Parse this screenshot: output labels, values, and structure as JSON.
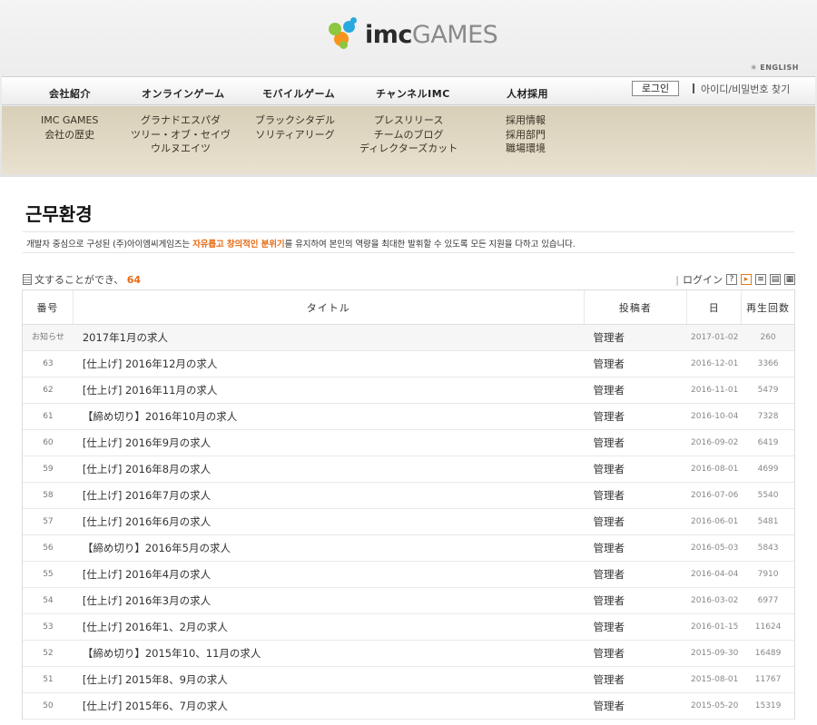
{
  "brand": {
    "logo_main": "imc",
    "logo_sub": "GAMES"
  },
  "header": {
    "lang_link": "ENGLISH",
    "menu": [
      "会社紹介",
      "オンラインゲーム",
      "モバイルゲーム",
      "チャンネルIMC",
      "人材採用"
    ],
    "login_button": "로그인",
    "find_link": "아이디/비밀번호 찾기"
  },
  "submenu": {
    "col1": [
      "IMC GAMES",
      "会社の歴史"
    ],
    "col2": [
      "グラナドエスパダ",
      "ツリー・オブ・セイヴ",
      "ウルヌエイツ"
    ],
    "col3": [
      "ブラックシタデル",
      "ソリティアリーグ"
    ],
    "col4": [
      "プレスリリース",
      "チームのブログ",
      "ディレクターズカット"
    ],
    "col5": [
      "採用情報",
      "採用部門",
      "職場環境"
    ]
  },
  "page": {
    "title": "근무환경",
    "desc_before": "개발자 중심으로 구성된 (주)아이엠씨게임즈는 ",
    "desc_highlight": "자유롭고 창의적인 분위기",
    "desc_after": "를 유지하여 본인의 역량을 최대한 발휘할 수 있도록 모든 지원을 다하고 있습니다."
  },
  "board": {
    "count_label": "文することができ、",
    "count_value": "64",
    "login_label": "ログイン",
    "columns": {
      "no": "番号",
      "title": "タイトル",
      "author": "投稿者",
      "date": "日",
      "views": "再生回数"
    },
    "rows": [
      {
        "no": "お知らせ",
        "title": "2017年1月の求人",
        "author": "管理者",
        "date": "2017-01-02",
        "views": "260",
        "notice": true
      },
      {
        "no": "63",
        "title": "[仕上げ] 2016年12月の求人",
        "author": "管理者",
        "date": "2016-12-01",
        "views": "3366"
      },
      {
        "no": "62",
        "title": "[仕上げ] 2016年11月の求人",
        "author": "管理者",
        "date": "2016-11-01",
        "views": "5479"
      },
      {
        "no": "61",
        "title": "【締め切り】2016年10月の求人",
        "author": "管理者",
        "date": "2016-10-04",
        "views": "7328"
      },
      {
        "no": "60",
        "title": "[仕上げ] 2016年9月の求人",
        "author": "管理者",
        "date": "2016-09-02",
        "views": "6419"
      },
      {
        "no": "59",
        "title": "[仕上げ] 2016年8月の求人",
        "author": "管理者",
        "date": "2016-08-01",
        "views": "4699"
      },
      {
        "no": "58",
        "title": "[仕上げ] 2016年7月の求人",
        "author": "管理者",
        "date": "2016-07-06",
        "views": "5540"
      },
      {
        "no": "57",
        "title": "[仕上げ] 2016年6月の求人",
        "author": "管理者",
        "date": "2016-06-01",
        "views": "5481"
      },
      {
        "no": "56",
        "title": "【締め切り】2016年5月の求人",
        "author": "管理者",
        "date": "2016-05-03",
        "views": "5843"
      },
      {
        "no": "55",
        "title": "[仕上げ] 2016年4月の求人",
        "author": "管理者",
        "date": "2016-04-04",
        "views": "7910"
      },
      {
        "no": "54",
        "title": "[仕上げ] 2016年3月の求人",
        "author": "管理者",
        "date": "2016-03-02",
        "views": "6977"
      },
      {
        "no": "53",
        "title": "[仕上げ] 2016年1、2月の求人",
        "author": "管理者",
        "date": "2016-01-15",
        "views": "11624"
      },
      {
        "no": "52",
        "title": "【締め切り】2015年10、11月の求人",
        "author": "管理者",
        "date": "2015-09-30",
        "views": "16489"
      },
      {
        "no": "51",
        "title": "[仕上げ] 2015年8、9月の求人",
        "author": "管理者",
        "date": "2015-08-01",
        "views": "11767"
      },
      {
        "no": "50",
        "title": "[仕上げ] 2015年6、7月の求人",
        "author": "管理者",
        "date": "2015-05-20",
        "views": "15319"
      }
    ]
  },
  "colors": {
    "accent": "#e76b15",
    "submenu_bg": "#e0d7c3",
    "logo_green": "#8dc63f",
    "logo_blue": "#29a9e0",
    "logo_orange": "#f7941d"
  },
  "icons": [
    "logo-mark-icon",
    "document-icon",
    "help-icon",
    "rss-icon",
    "list-view-icon",
    "webzine-view-icon",
    "gallery-view-icon"
  ]
}
